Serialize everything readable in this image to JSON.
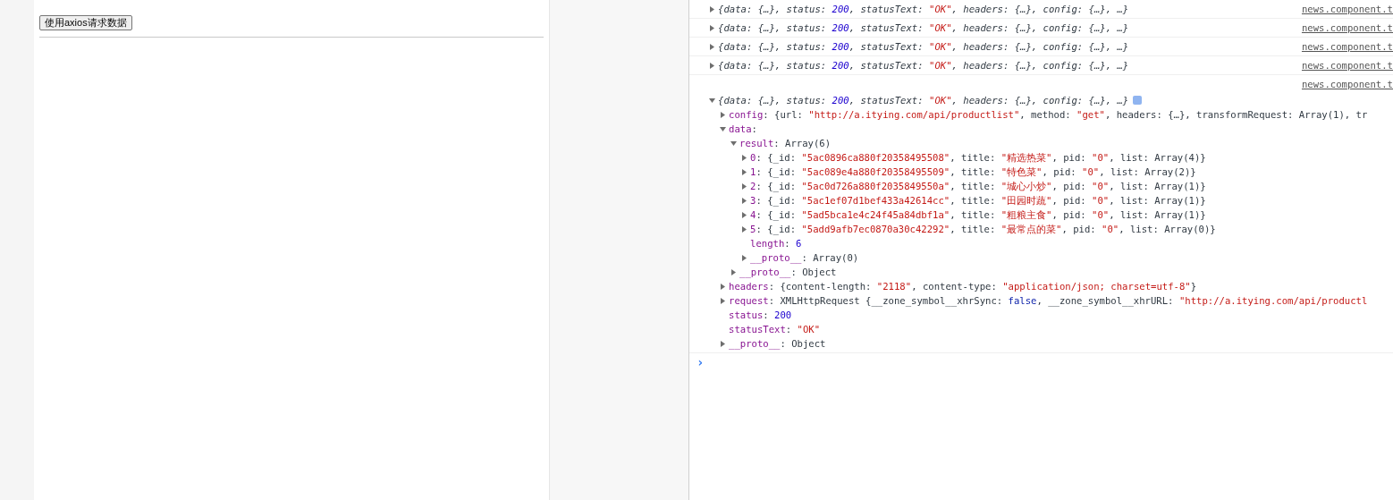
{
  "page": {
    "button": "使用axios请求数据"
  },
  "console": {
    "logs": [
      {
        "expanded": false,
        "source": "news.component.t",
        "summary": [
          {
            "kind": "plain",
            "text": "{data: {…}, status: "
          },
          {
            "kind": "number",
            "text": "200"
          },
          {
            "kind": "plain",
            "text": ", statusText: "
          },
          {
            "kind": "string",
            "text": "\"OK\""
          },
          {
            "kind": "plain",
            "text": ", headers: {…}, config: {…}, …}"
          }
        ]
      },
      {
        "expanded": false,
        "source": "news.component.t",
        "summary": [
          {
            "kind": "plain",
            "text": "{data: {…}, status: "
          },
          {
            "kind": "number",
            "text": "200"
          },
          {
            "kind": "plain",
            "text": ", statusText: "
          },
          {
            "kind": "string",
            "text": "\"OK\""
          },
          {
            "kind": "plain",
            "text": ", headers: {…}, config: {…}, …}"
          }
        ]
      },
      {
        "expanded": false,
        "source": "news.component.t",
        "summary": [
          {
            "kind": "plain",
            "text": "{data: {…}, status: "
          },
          {
            "kind": "number",
            "text": "200"
          },
          {
            "kind": "plain",
            "text": ", statusText: "
          },
          {
            "kind": "string",
            "text": "\"OK\""
          },
          {
            "kind": "plain",
            "text": ", headers: {…}, config: {…}, …}"
          }
        ]
      },
      {
        "expanded": false,
        "source": "news.component.t",
        "summary": [
          {
            "kind": "plain",
            "text": "{data: {…}, status: "
          },
          {
            "kind": "number",
            "text": "200"
          },
          {
            "kind": "plain",
            "text": ", statusText: "
          },
          {
            "kind": "string",
            "text": "\"OK\""
          },
          {
            "kind": "plain",
            "text": ", headers: {…}, config: {…}, …}"
          }
        ]
      },
      {
        "expanded": true,
        "source": "news.component.t",
        "summary": [
          {
            "kind": "plain",
            "text": "{data: {…}, status: "
          },
          {
            "kind": "number",
            "text": "200"
          },
          {
            "kind": "plain",
            "text": ", statusText: "
          },
          {
            "kind": "string",
            "text": "\"OK\""
          },
          {
            "kind": "plain",
            "text": ", headers: {…}, config: {…}, …}"
          }
        ],
        "children": [
          {
            "expanded": false,
            "parts": [
              {
                "kind": "key",
                "text": "config"
              },
              {
                "kind": "plain",
                "text": ": {url: "
              },
              {
                "kind": "string",
                "text": "\"http://a.itying.com/api/productlist\""
              },
              {
                "kind": "plain",
                "text": ", method: "
              },
              {
                "kind": "string",
                "text": "\"get\""
              },
              {
                "kind": "plain",
                "text": ", headers: {…}, transformRequest: Array(1), tr"
              }
            ]
          },
          {
            "expanded": true,
            "parts": [
              {
                "kind": "key",
                "text": "data"
              },
              {
                "kind": "plain",
                "text": ":"
              }
            ],
            "children": [
              {
                "expanded": true,
                "parts": [
                  {
                    "kind": "key",
                    "text": "result"
                  },
                  {
                    "kind": "plain",
                    "text": ": Array(6)"
                  }
                ],
                "children": [
                  {
                    "expanded": false,
                    "parts": [
                      {
                        "kind": "key",
                        "text": "0"
                      },
                      {
                        "kind": "plain",
                        "text": ": {_id: "
                      },
                      {
                        "kind": "string",
                        "text": "\"5ac0896ca880f20358495508\""
                      },
                      {
                        "kind": "plain",
                        "text": ", title: "
                      },
                      {
                        "kind": "string",
                        "text": "\"精选热菜\""
                      },
                      {
                        "kind": "plain",
                        "text": ", pid: "
                      },
                      {
                        "kind": "string",
                        "text": "\"0\""
                      },
                      {
                        "kind": "plain",
                        "text": ", list: Array(4)}"
                      }
                    ]
                  },
                  {
                    "expanded": false,
                    "parts": [
                      {
                        "kind": "key",
                        "text": "1"
                      },
                      {
                        "kind": "plain",
                        "text": ": {_id: "
                      },
                      {
                        "kind": "string",
                        "text": "\"5ac089e4a880f20358495509\""
                      },
                      {
                        "kind": "plain",
                        "text": ", title: "
                      },
                      {
                        "kind": "string",
                        "text": "\"特色菜\""
                      },
                      {
                        "kind": "plain",
                        "text": ", pid: "
                      },
                      {
                        "kind": "string",
                        "text": "\"0\""
                      },
                      {
                        "kind": "plain",
                        "text": ", list: Array(2)}"
                      }
                    ]
                  },
                  {
                    "expanded": false,
                    "parts": [
                      {
                        "kind": "key",
                        "text": "2"
                      },
                      {
                        "kind": "plain",
                        "text": ": {_id: "
                      },
                      {
                        "kind": "string",
                        "text": "\"5ac0d726a880f2035849550a\""
                      },
                      {
                        "kind": "plain",
                        "text": ", title: "
                      },
                      {
                        "kind": "string",
                        "text": "\"城心小炒\""
                      },
                      {
                        "kind": "plain",
                        "text": ", pid: "
                      },
                      {
                        "kind": "string",
                        "text": "\"0\""
                      },
                      {
                        "kind": "plain",
                        "text": ", list: Array(1)}"
                      }
                    ]
                  },
                  {
                    "expanded": false,
                    "parts": [
                      {
                        "kind": "key",
                        "text": "3"
                      },
                      {
                        "kind": "plain",
                        "text": ": {_id: "
                      },
                      {
                        "kind": "string",
                        "text": "\"5ac1ef07d1bef433a42614cc\""
                      },
                      {
                        "kind": "plain",
                        "text": ", title: "
                      },
                      {
                        "kind": "string",
                        "text": "\"田园时蔬\""
                      },
                      {
                        "kind": "plain",
                        "text": ", pid: "
                      },
                      {
                        "kind": "string",
                        "text": "\"0\""
                      },
                      {
                        "kind": "plain",
                        "text": ", list: Array(1)}"
                      }
                    ]
                  },
                  {
                    "expanded": false,
                    "parts": [
                      {
                        "kind": "key",
                        "text": "4"
                      },
                      {
                        "kind": "plain",
                        "text": ": {_id: "
                      },
                      {
                        "kind": "string",
                        "text": "\"5ad5bca1e4c24f45a84dbf1a\""
                      },
                      {
                        "kind": "plain",
                        "text": ", title: "
                      },
                      {
                        "kind": "string",
                        "text": "\"粗粮主食\""
                      },
                      {
                        "kind": "plain",
                        "text": ", pid: "
                      },
                      {
                        "kind": "string",
                        "text": "\"0\""
                      },
                      {
                        "kind": "plain",
                        "text": ", list: Array(1)}"
                      }
                    ]
                  },
                  {
                    "expanded": false,
                    "parts": [
                      {
                        "kind": "key",
                        "text": "5"
                      },
                      {
                        "kind": "plain",
                        "text": ": {_id: "
                      },
                      {
                        "kind": "string",
                        "text": "\"5add9afb7ec0870a30c42292\""
                      },
                      {
                        "kind": "plain",
                        "text": ", title: "
                      },
                      {
                        "kind": "string",
                        "text": "\"最常点的菜\""
                      },
                      {
                        "kind": "plain",
                        "text": ", pid: "
                      },
                      {
                        "kind": "string",
                        "text": "\"0\""
                      },
                      {
                        "kind": "plain",
                        "text": ", list: Array(0)}"
                      }
                    ]
                  },
                  {
                    "parts": [
                      {
                        "kind": "key",
                        "text": "length"
                      },
                      {
                        "kind": "plain",
                        "text": ": "
                      },
                      {
                        "kind": "number",
                        "text": "6"
                      }
                    ]
                  },
                  {
                    "expanded": false,
                    "parts": [
                      {
                        "kind": "key",
                        "text": "__proto__"
                      },
                      {
                        "kind": "plain",
                        "text": ": Array(0)"
                      }
                    ]
                  }
                ]
              },
              {
                "expanded": false,
                "parts": [
                  {
                    "kind": "key",
                    "text": "__proto__"
                  },
                  {
                    "kind": "plain",
                    "text": ": Object"
                  }
                ]
              }
            ]
          },
          {
            "expanded": false,
            "parts": [
              {
                "kind": "key",
                "text": "headers"
              },
              {
                "kind": "plain",
                "text": ": {content-length: "
              },
              {
                "kind": "string",
                "text": "\"2118\""
              },
              {
                "kind": "plain",
                "text": ", content-type: "
              },
              {
                "kind": "string",
                "text": "\"application/json; charset=utf-8\""
              },
              {
                "kind": "plain",
                "text": "}"
              }
            ]
          },
          {
            "expanded": false,
            "parts": [
              {
                "kind": "key",
                "text": "request"
              },
              {
                "kind": "plain",
                "text": ": XMLHttpRequest {__zone_symbol__xhrSync: "
              },
              {
                "kind": "bool",
                "text": "false"
              },
              {
                "kind": "plain",
                "text": ", __zone_symbol__xhrURL: "
              },
              {
                "kind": "string",
                "text": "\"http://a.itying.com/api/productl"
              }
            ]
          },
          {
            "parts": [
              {
                "kind": "key",
                "text": "status"
              },
              {
                "kind": "plain",
                "text": ": "
              },
              {
                "kind": "number",
                "text": "200"
              }
            ]
          },
          {
            "parts": [
              {
                "kind": "key",
                "text": "statusText"
              },
              {
                "kind": "plain",
                "text": ": "
              },
              {
                "kind": "string",
                "text": "\"OK\""
              }
            ]
          },
          {
            "expanded": false,
            "parts": [
              {
                "kind": "key",
                "text": "__proto__"
              },
              {
                "kind": "plain",
                "text": ": Object"
              }
            ]
          }
        ]
      }
    ],
    "prompt": "›"
  }
}
